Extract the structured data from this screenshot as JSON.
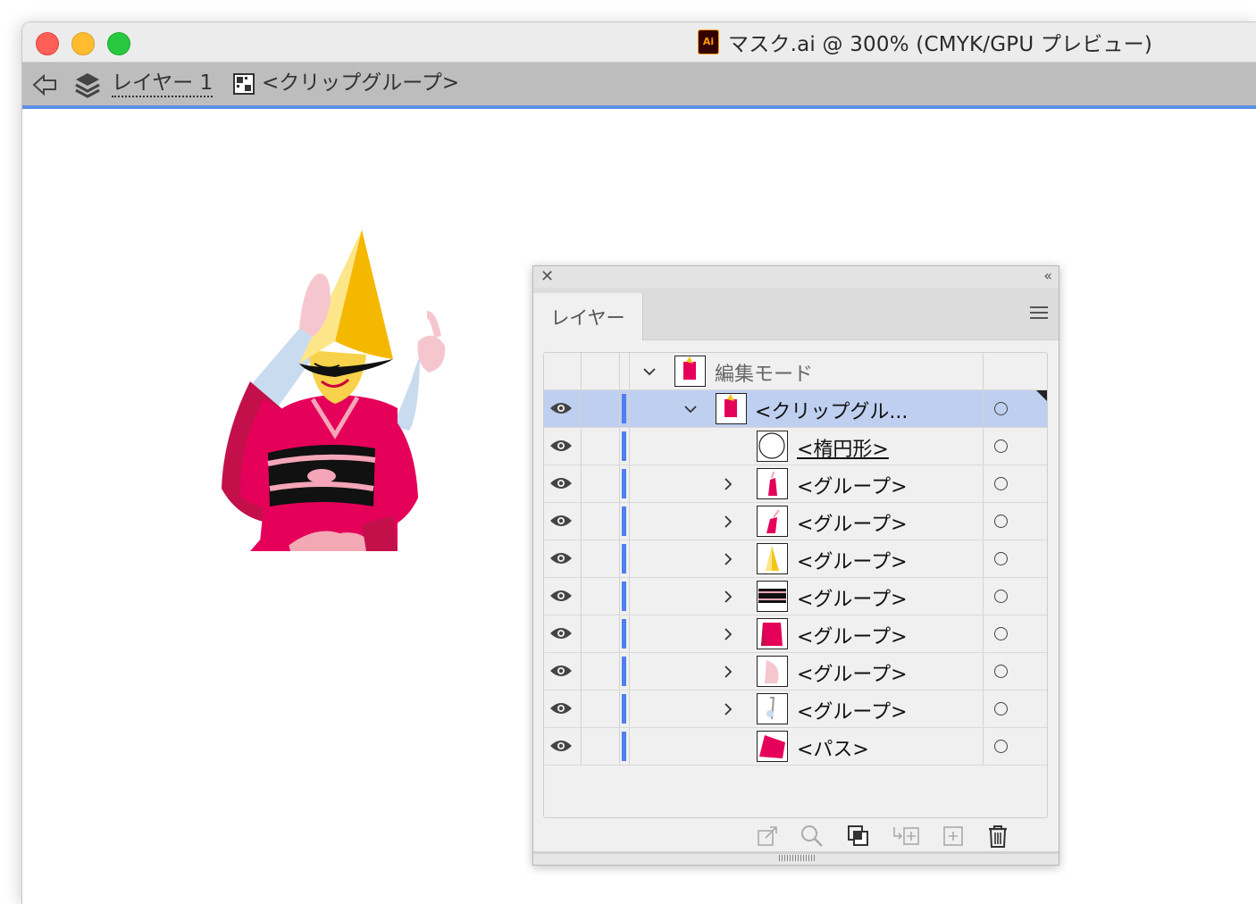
{
  "window": {
    "title": "マスク.ai @ 300% (CMYK/GPU プレビュー)",
    "app_icon_label": "Ai"
  },
  "breadcrumb": {
    "layer_label": "レイヤー 1",
    "group_label": "<クリップグループ>"
  },
  "panel": {
    "tab_label": "レイヤー",
    "rows": [
      {
        "name": "編集モード",
        "visible": false,
        "expand": "down",
        "thumb": "figure",
        "muted": true
      },
      {
        "name": "<クリップグル...",
        "visible": true,
        "expand": "down",
        "thumb": "figure",
        "selected": true
      },
      {
        "name": "<楕円形>",
        "visible": true,
        "expand": "none",
        "thumb": "circle",
        "underline": true
      },
      {
        "name": "<グループ>",
        "visible": true,
        "expand": "right",
        "thumb": "pink-shape"
      },
      {
        "name": "<グループ>",
        "visible": true,
        "expand": "right",
        "thumb": "pink-shape-2"
      },
      {
        "name": "<グループ>",
        "visible": true,
        "expand": "right",
        "thumb": "yellow-hat"
      },
      {
        "name": "<グループ>",
        "visible": true,
        "expand": "right",
        "thumb": "black-obi"
      },
      {
        "name": "<グループ>",
        "visible": true,
        "expand": "right",
        "thumb": "red-kimono"
      },
      {
        "name": "<グループ>",
        "visible": true,
        "expand": "right",
        "thumb": "skin"
      },
      {
        "name": "<グループ>",
        "visible": true,
        "expand": "right",
        "thumb": "hand"
      },
      {
        "name": "<パス>",
        "visible": true,
        "expand": "none",
        "thumb": "pink-path"
      }
    ],
    "footer_icons": [
      "export-icon",
      "search-icon",
      "clipping-mask-icon",
      "move-to-layer-icon",
      "new-sublayer-icon",
      "trash-icon"
    ]
  },
  "colors": {
    "accent": "#4f7ef0",
    "selected_row": "#bfcff0",
    "kimono": "#e5005a",
    "hat": "#f5c518"
  }
}
